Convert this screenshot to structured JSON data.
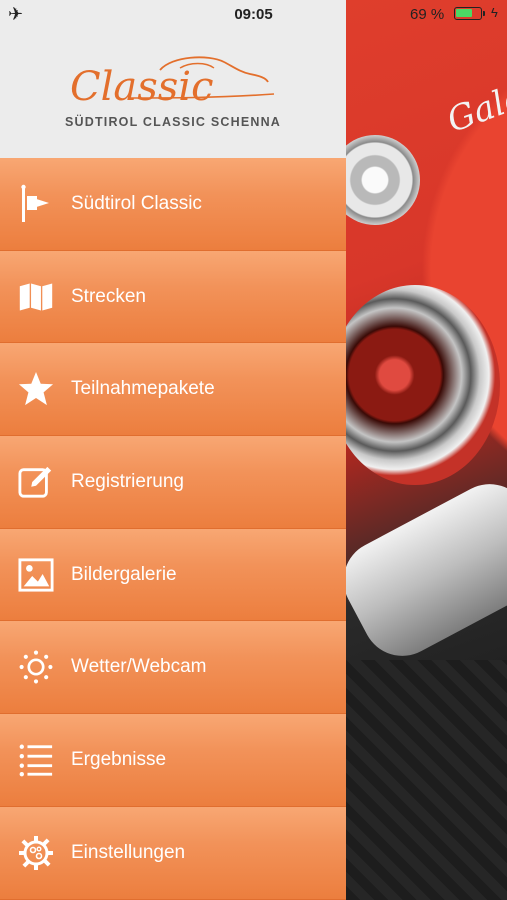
{
  "status_bar": {
    "time": "09:05",
    "battery_text": "69 %",
    "battery_level": 0.69
  },
  "logo": {
    "script_text": "Classic",
    "subtitle": "SÜDTIROL CLASSIC SCHENNA",
    "color": "#e36f2c"
  },
  "background": {
    "script_text": "Galaxie"
  },
  "menu": {
    "items": [
      {
        "label": "Südtirol Classic",
        "icon": "flag-icon"
      },
      {
        "label": "Strecken",
        "icon": "map-icon"
      },
      {
        "label": "Teilnahmepakete",
        "icon": "star-icon"
      },
      {
        "label": "Registrierung",
        "icon": "edit-icon"
      },
      {
        "label": "Bildergalerie",
        "icon": "image-icon"
      },
      {
        "label": "Wetter/Webcam",
        "icon": "sun-icon"
      },
      {
        "label": "Ergebnisse",
        "icon": "list-icon"
      },
      {
        "label": "Einstellungen",
        "icon": "settings-icon"
      }
    ]
  },
  "colors": {
    "accent": "#ec7e3e",
    "battery": "#4cd964"
  }
}
